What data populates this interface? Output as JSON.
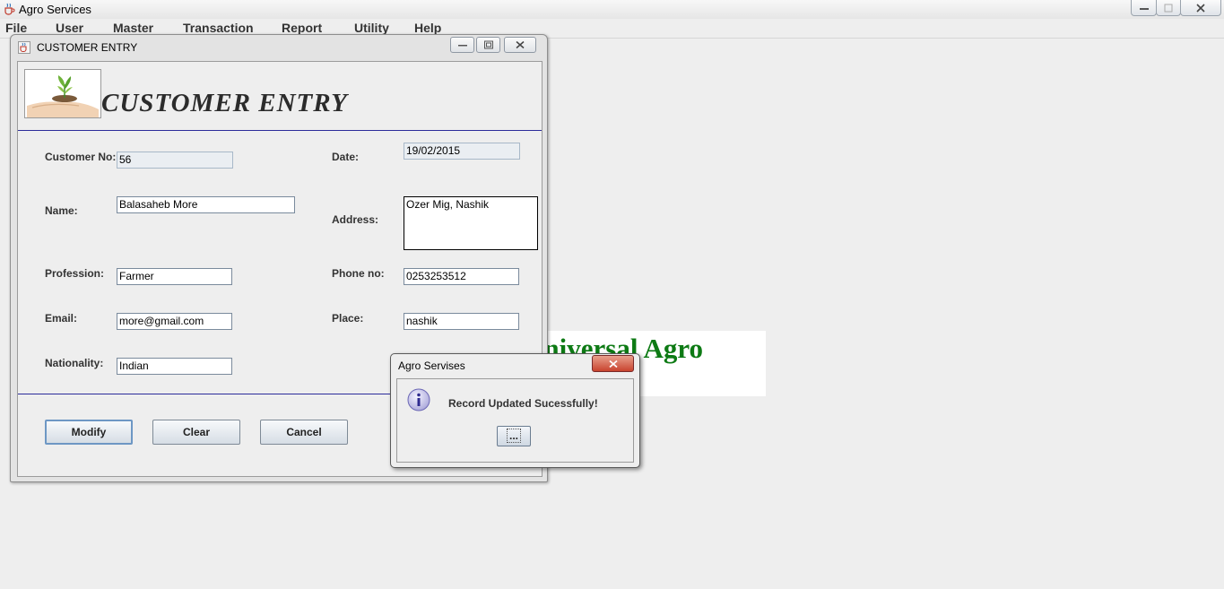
{
  "app": {
    "title": "Agro Services",
    "menu": [
      "File",
      "User",
      "Master",
      "Transaction",
      "Report",
      "Utility",
      "Help"
    ]
  },
  "frame": {
    "title": "CUSTOMER ENTRY",
    "heading": "CUSTOMER ENTRY"
  },
  "form": {
    "customer_no": {
      "label": "Customer No:",
      "value": "56"
    },
    "date": {
      "label": "Date:",
      "value": "19/02/2015"
    },
    "name": {
      "label": "Name:",
      "value": "Balasaheb More"
    },
    "address": {
      "label": "Address:",
      "value": "Ozer Mig, Nashik"
    },
    "profession": {
      "label": "Profession:",
      "value": "Farmer"
    },
    "phone": {
      "label": "Phone no:",
      "value": "0253253512"
    },
    "email": {
      "label": "Email:",
      "value": "more@gmail.com"
    },
    "place": {
      "label": "Place:",
      "value": "nashik"
    },
    "nationality": {
      "label": "Nationality:",
      "value": "Indian"
    }
  },
  "buttons": {
    "modify": "Modify",
    "clear": "Clear",
    "cancel": "Cancel"
  },
  "banner": {
    "text": "Universal Agro\n Services"
  },
  "dialog": {
    "title": "Agro Servises",
    "message": "Record Updated Sucessfully!",
    "ok_label": "..."
  },
  "colors": {
    "accent_divider": "#2b2b9a",
    "banner_text": "#0d7a14",
    "close_button": "#c8432e"
  }
}
